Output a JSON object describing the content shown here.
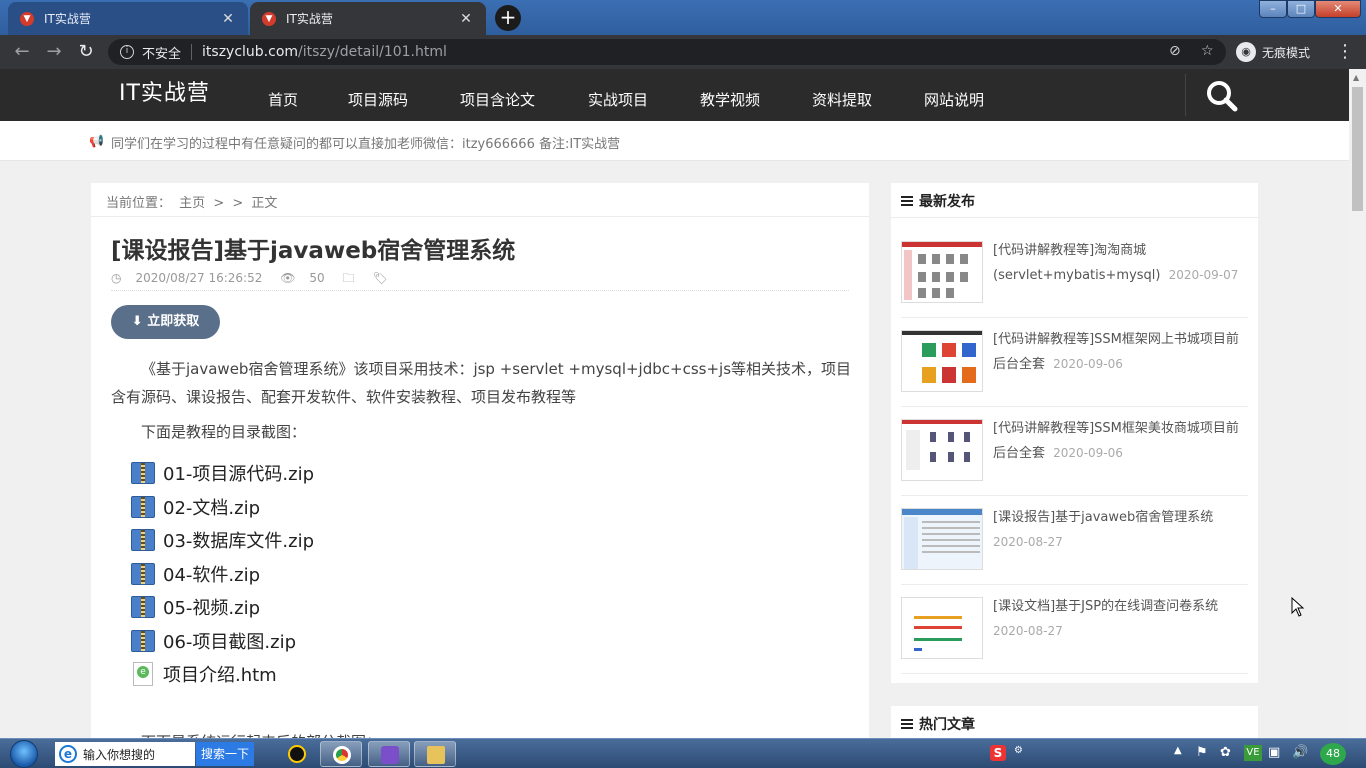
{
  "browser": {
    "tabs": [
      {
        "title": "IT实战营",
        "active": false
      },
      {
        "title": "IT实战营",
        "active": true
      }
    ],
    "address": {
      "security_label": "不安全",
      "host": "itszyclub.com",
      "path": "/itszy/detail/101.html"
    },
    "incognito_label": "无痕模式"
  },
  "site": {
    "logo": "IT实战营",
    "nav": [
      "首页",
      "项目源码",
      "项目含论文",
      "实战项目",
      "教学视频",
      "资料提取",
      "网站说明"
    ],
    "notice": "同学们在学习的过程中有任意疑问的都可以直接加老师微信：itzy666666 备注:IT实战营"
  },
  "breadcrumb": {
    "prefix": "当前位置：",
    "home": "主页",
    "sep1": ">",
    "sep2": ">",
    "current": "正文"
  },
  "article": {
    "title": "[课设报告]基于javaweb宿舍管理系统",
    "datetime": "2020/08/27 16:26:52",
    "views": "50",
    "get_button": "立即获取",
    "intro": "《基于javaweb宿舍管理系统》该项目采用技术：jsp +servlet +mysql+jdbc+css+js等相关技术，项目含有源码、课设报告、配套开发软件、软件安装教程、项目发布教程等",
    "toc_intro": "下面是教程的目录截图：",
    "files": [
      {
        "name": "01-项目源代码.zip",
        "type": "zip"
      },
      {
        "name": "02-文档.zip",
        "type": "zip"
      },
      {
        "name": "03-数据库文件.zip",
        "type": "zip"
      },
      {
        "name": "04-软件.zip",
        "type": "zip"
      },
      {
        "name": "05-视频.zip",
        "type": "zip"
      },
      {
        "name": "06-项目截图.zip",
        "type": "zip"
      },
      {
        "name": "项目介绍.htm",
        "type": "htm"
      }
    ],
    "cut_text": "下面是系统运行起来后的部分截图："
  },
  "sidebar": {
    "latest_title": "最新发布",
    "posts": [
      {
        "title": "[代码讲解教程等]淘淘商城(servlet+mybatis+mysql)",
        "date": "2020-09-07"
      },
      {
        "title": "[代码讲解教程等]SSM框架网上书城项目前后台全套",
        "date": "2020-09-06"
      },
      {
        "title": "[代码讲解教程等]SSM框架美妆商城项目前后台全套",
        "date": "2020-09-06"
      },
      {
        "title": "[课设报告]基于javaweb宿舍管理系统",
        "date": "2020-08-27"
      },
      {
        "title": "[课设文档]基于JSP的在线调查问卷系统",
        "date": "2020-08-27"
      }
    ],
    "hot_title": "热门文章"
  },
  "taskbar": {
    "search_placeholder": "输入你想搜的",
    "search_button": "搜索一下",
    "battery": "48"
  },
  "colors": {
    "header_bg": "#2b2b2b",
    "button_bg": "#5a6f8a",
    "page_bg": "#f0f0f0"
  }
}
